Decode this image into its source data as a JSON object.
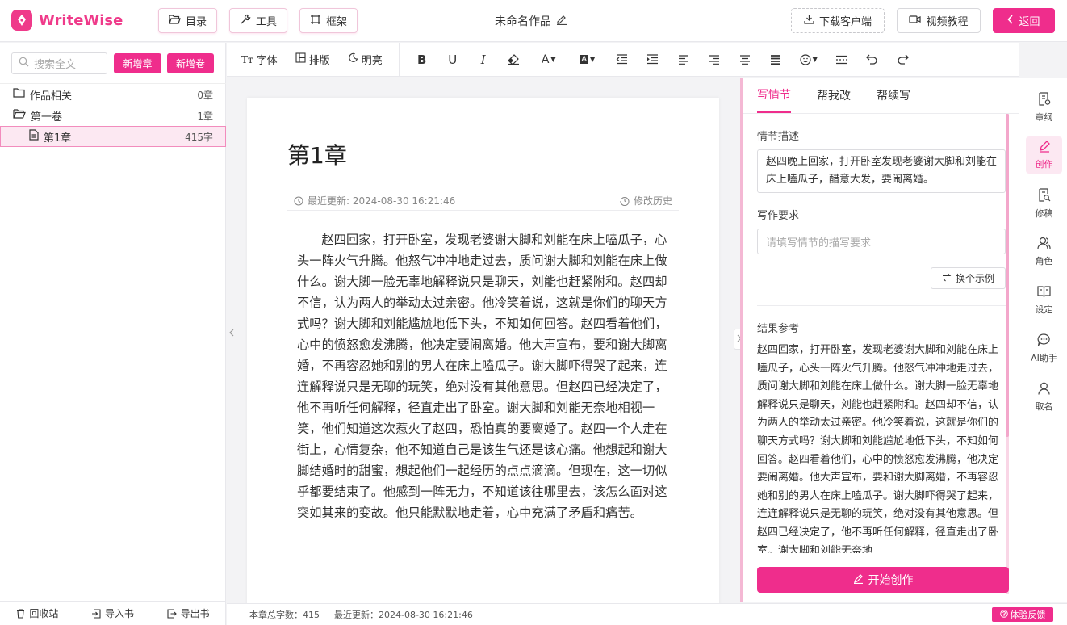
{
  "app": {
    "name": "WriteWise",
    "doc_title": "未命名作品"
  },
  "topbar": {
    "catalog": "目录",
    "tools": "工具",
    "frame": "框架",
    "download": "下载客户端",
    "video": "视频教程",
    "back": "返回"
  },
  "sidebar": {
    "search_placeholder": "搜索全文",
    "new_chapter": "新增章",
    "new_volume": "新增卷",
    "tree": [
      {
        "name": "作品相关",
        "count": "0章"
      },
      {
        "name": "第一卷",
        "count": "1章"
      },
      {
        "name": "第1章",
        "count": "415字"
      }
    ],
    "footer": {
      "recycle": "回收站",
      "import": "导入书",
      "export": "导出书"
    }
  },
  "toolbar": {
    "font": "字体",
    "layout": "排版",
    "brightness": "明亮"
  },
  "editor": {
    "chapter_title": "第1章",
    "last_update": "最近更新: 2024-08-30 16:21:46",
    "history": "修改历史",
    "content": "赵四回家，打开卧室，发现老婆谢大脚和刘能在床上嗑瓜子，心头一阵火气升腾。他怒气冲冲地走过去，质问谢大脚和刘能在床上做什么。谢大脚一脸无辜地解释说只是聊天，刘能也赶紧附和。赵四却不信，认为两人的举动太过亲密。他冷笑着说，这就是你们的聊天方式吗？谢大脚和刘能尴尬地低下头，不知如何回答。赵四看着他们，心中的愤怒愈发沸腾，他决定要闹离婚。他大声宣布，要和谢大脚离婚，不再容忍她和别的男人在床上嗑瓜子。谢大脚吓得哭了起来，连连解释说只是无聊的玩笑，绝对没有其他意思。但赵四已经决定了，他不再听任何解释，径直走出了卧室。谢大脚和刘能无奈地相视一笑，他们知道这次惹火了赵四，恐怕真的要离婚了。赵四一个人走在街上，心情复杂，他不知道自己是该生气还是该心痛。他想起和谢大脚结婚时的甜蜜，想起他们一起经历的点点滴滴。但现在，这一切似乎都要结束了。他感到一阵无力，不知道该往哪里去，该怎么面对这突如其来的变故。他只能默默地走着，心中充满了矛盾和痛苦。"
  },
  "status": {
    "word_count": "本章总字数：415",
    "last_update": "最近更新：2024-08-30 16:21:46",
    "feedback": "体验反馈"
  },
  "panel": {
    "tabs": [
      "写情节",
      "帮我改",
      "帮续写"
    ],
    "plot_label": "情节描述",
    "plot_value": "赵四晚上回家，打开卧室发现老婆谢大脚和刘能在床上嗑瓜子，醋意大发，要闹离婚。",
    "req_label": "写作要求",
    "req_placeholder": "请填写情节的描写要求",
    "swap": "换个示例",
    "result_label": "结果参考",
    "result_text": "赵四回家，打开卧室，发现老婆谢大脚和刘能在床上嗑瓜子，心头一阵火气升腾。他怒气冲冲地走过去，质问谢大脚和刘能在床上做什么。谢大脚一脸无辜地解释说只是聊天，刘能也赶紧附和。赵四却不信，认为两人的举动太过亲密。他冷笑着说，这就是你们的聊天方式吗？谢大脚和刘能尴尬地低下头，不知如何回答。赵四看着他们，心中的愤怒愈发沸腾，他决定要闹离婚。他大声宣布，要和谢大脚离婚，不再容忍她和别的男人在床上嗑瓜子。谢大脚吓得哭了起来，连连解释说只是无聊的玩笑，绝对没有其他意思。但赵四已经决定了，他不再听任何解释，径直走出了卧室。谢大脚和刘能无奈地",
    "start": "开始创作"
  },
  "rail": [
    "章纲",
    "创作",
    "修稿",
    "角色",
    "设定",
    "AI助手",
    "取名"
  ],
  "colors": {
    "accent": "#ef2d8c"
  }
}
